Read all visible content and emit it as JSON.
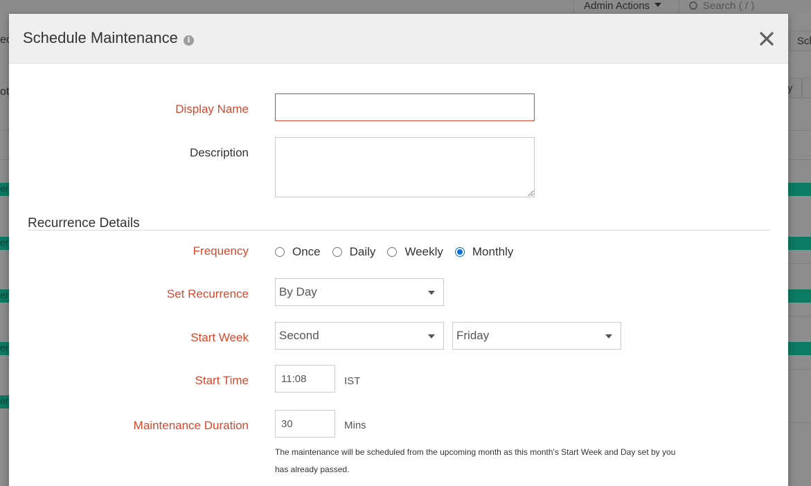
{
  "background": {
    "admin_actions": "Admin Actions",
    "search_placeholder": "Search ( / )",
    "left_fragments": [
      "ec",
      "ot",
      "er",
      "er",
      "er",
      "er",
      "er"
    ],
    "right_fragments": [
      "Sch",
      "y"
    ]
  },
  "modal": {
    "title": "Schedule Maintenance",
    "info_icon": "info-icon",
    "close_icon": "close-icon"
  },
  "form": {
    "display_name": {
      "label": "Display Name",
      "value": ""
    },
    "description": {
      "label": "Description",
      "value": ""
    },
    "recurrence_section": "Recurrence Details",
    "frequency": {
      "label": "Frequency",
      "options": [
        "Once",
        "Daily",
        "Weekly",
        "Monthly"
      ],
      "selected": "Monthly"
    },
    "set_recurrence": {
      "label": "Set Recurrence",
      "value": "By Day"
    },
    "start_week": {
      "label": "Start Week",
      "week_value": "Second",
      "day_value": "Friday"
    },
    "start_time": {
      "label": "Start Time",
      "value": "11:08",
      "unit": "IST"
    },
    "duration": {
      "label": "Maintenance Duration",
      "value": "30",
      "unit": "Mins"
    },
    "note": "The maintenance will be scheduled from the upcoming month as this month's Start Week and Day set by you has already passed."
  },
  "colors": {
    "required_label": "#d9472b",
    "radio_accent": "#0a6fd6",
    "background_status": "#0d7a64"
  }
}
